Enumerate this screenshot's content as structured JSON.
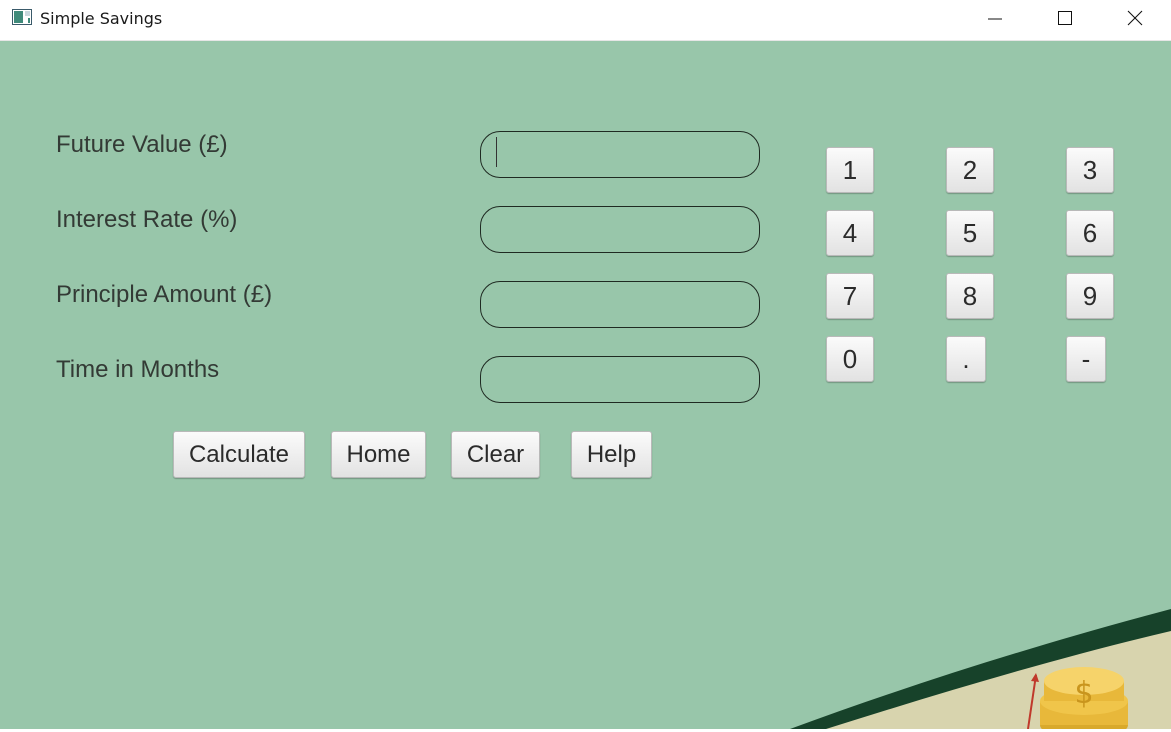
{
  "window": {
    "title": "Simple Savings"
  },
  "form": {
    "fields": [
      {
        "label": "Future Value (£)",
        "value": ""
      },
      {
        "label": "Interest Rate (%)",
        "value": ""
      },
      {
        "label": "Principle Amount (£)",
        "value": ""
      },
      {
        "label": "Time in Months",
        "value": ""
      }
    ]
  },
  "keypad": {
    "keys": [
      "1",
      "2",
      "3",
      "4",
      "5",
      "6",
      "7",
      "8",
      "9",
      "0",
      ".",
      "-"
    ]
  },
  "actions": {
    "calculate": "Calculate",
    "home": "Home",
    "clear": "Clear",
    "help": "Help"
  },
  "decoration": {
    "coin_symbol": "$"
  },
  "colors": {
    "background": "#98c6aa",
    "curve": "#17422a",
    "ground": "#d8d4ae",
    "coin": "#f0c54a"
  }
}
